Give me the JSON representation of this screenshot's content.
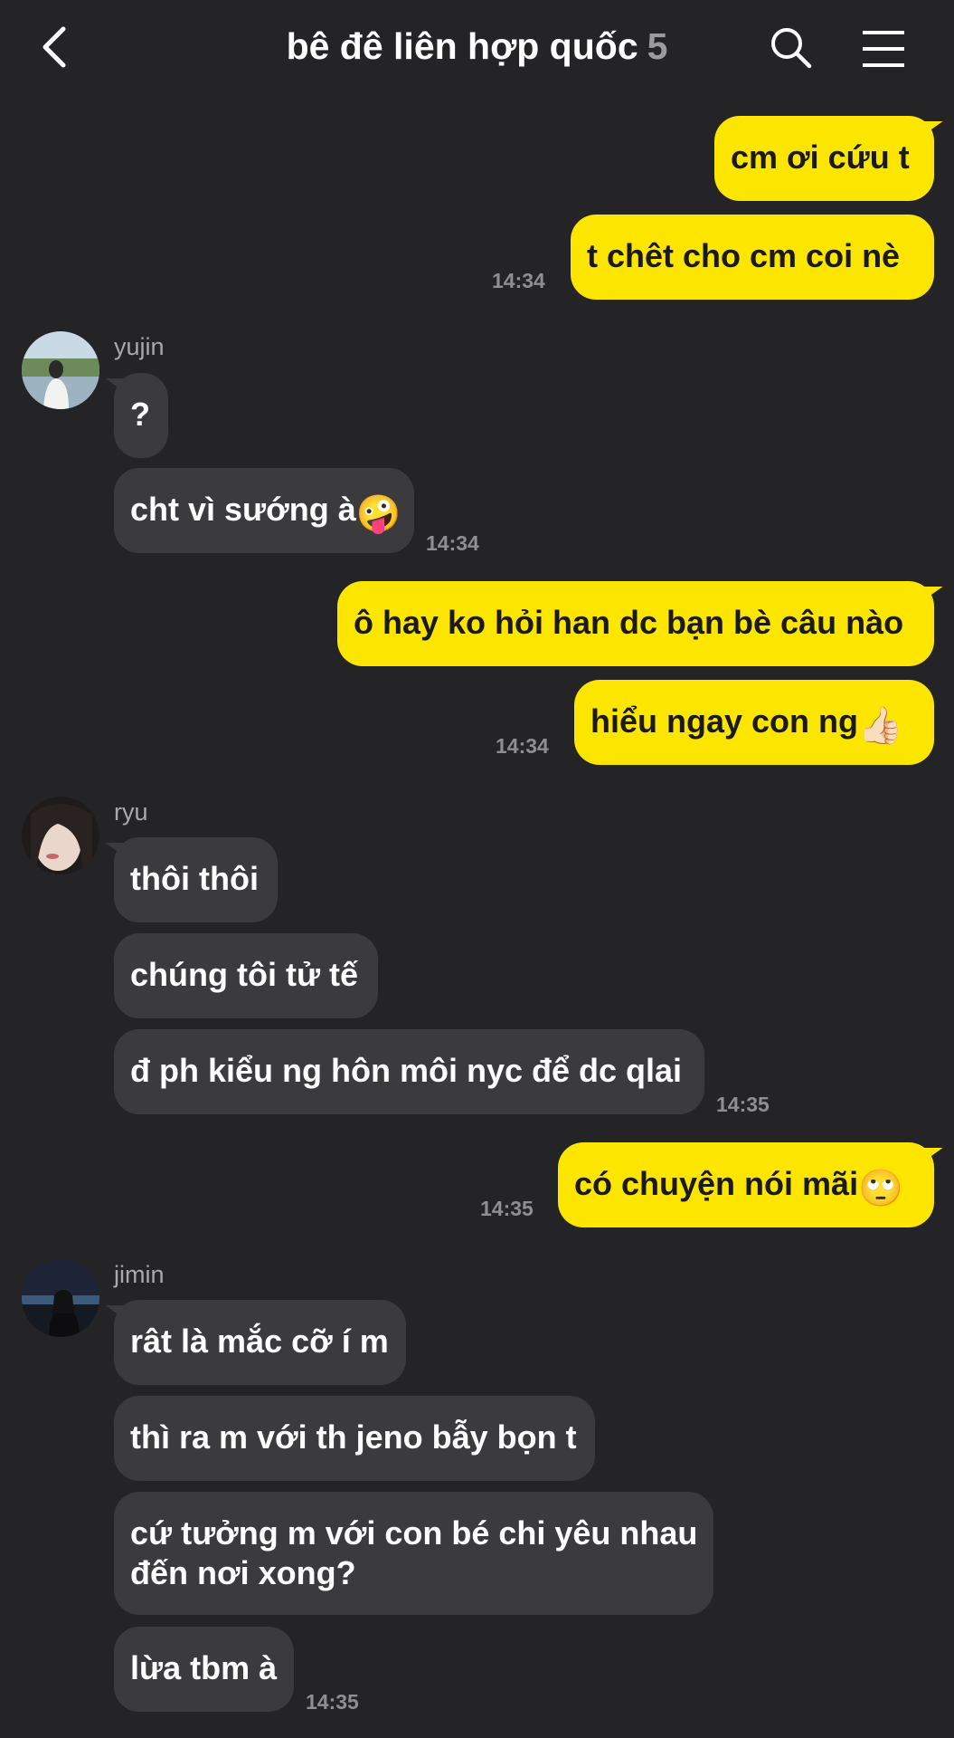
{
  "header": {
    "title": "bê đê liên hợp quốc",
    "count": "5",
    "back_icon": "chevron-left-icon",
    "search_icon": "search-icon",
    "menu_icon": "hamburger-menu-icon"
  },
  "colors": {
    "background": "#242427",
    "mine_bubble": "#fce600",
    "their_bubble": "#3b3b3e",
    "timestamp": "#8e8e93"
  },
  "messages": {
    "m1": "cm ơi cứu t",
    "m2": "t chêt cho cm coi nè",
    "m2_time": "14:34",
    "yujin_name": "yujin",
    "y1": "?",
    "y2": "cht vì sướng à",
    "y2_emoji": "🤪",
    "y2_time": "14:34",
    "m3": "ô hay ko hỏi han dc bạn bè câu nào",
    "m4": "hiểu ngay con ng",
    "m4_emoji": "👍🏻",
    "m4_time": "14:34",
    "ryu_name": "ryu",
    "r1": "thôi thôi",
    "r2": "chúng tôi tử tế",
    "r3": "đ ph kiểu ng hôn môi nyc để dc qlai",
    "r3_time": "14:35",
    "m5": "có chuyện nói mãi",
    "m5_emoji": "🙄",
    "m5_time": "14:35",
    "jimin_name": "jimin",
    "j1": "rât là mắc cỡ í m",
    "j2": "thì ra m với th jeno bẫy bọn t",
    "j3_line1": "cứ tưởng m với con bé chi yêu nhau",
    "j3_line2": "đến nơi xong?",
    "j4": "lừa tbm à",
    "j4_time": "14:35"
  }
}
